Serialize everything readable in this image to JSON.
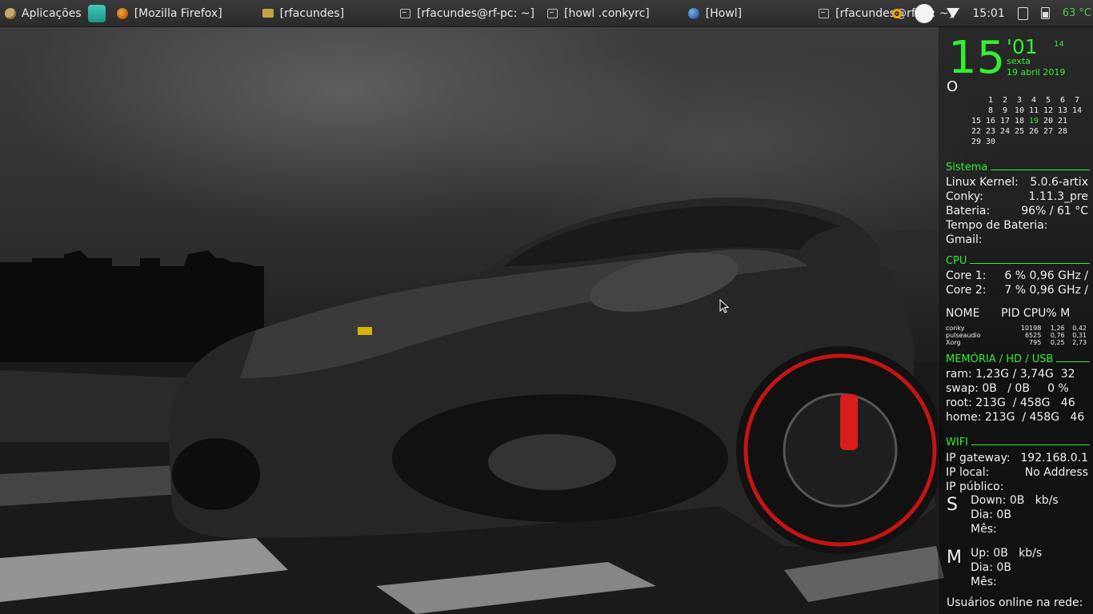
{
  "panel": {
    "apps_menu": "Aplicações",
    "tasks": [
      {
        "icon": "firefox-icon",
        "label": "[Mozilla Firefox]"
      },
      {
        "icon": "folder-icon",
        "label": "[rfacundes]"
      },
      {
        "icon": "terminal-icon",
        "label": "[rfacundes@rf-pc: ~]"
      },
      {
        "icon": "terminal-icon",
        "label": "[howl .conkyrc]"
      },
      {
        "icon": "globe-icon",
        "label": "[Howl]"
      },
      {
        "icon": "terminal-icon",
        "label": "[rfacundes@rf-pc: ~]"
      }
    ],
    "clock": "15:01",
    "temperature": "63 °C"
  },
  "conky": {
    "clock": {
      "hour": "15",
      "minute": "'01",
      "second": "14",
      "weekday": "sexta",
      "date": "19 abril 2019"
    },
    "glyph_o": "O",
    "calendar": [
      [
        "",
        "1",
        "2",
        "3",
        "4",
        "5",
        "6",
        "7"
      ],
      [
        "",
        "8",
        "9",
        "10",
        "11",
        "12",
        "13",
        "14"
      ],
      [
        "15",
        "16",
        "17",
        "18",
        "19",
        "20",
        "21",
        ""
      ],
      [
        "22",
        "23",
        "24",
        "25",
        "26",
        "27",
        "28",
        ""
      ],
      [
        "29",
        "30",
        "",
        "",
        "",
        "",
        "",
        ""
      ]
    ],
    "calendar_today": "19",
    "sistema": {
      "title": "Sistema",
      "kernel_label": "Linux Kernel:",
      "kernel": "5.0.6-artix",
      "conky_label": "Conky:",
      "conky": "1.11.3_pre",
      "battery_label": "Bateria:",
      "battery": "96% / 61 °C",
      "battery_time_label": "Tempo de Bateria:",
      "gmail_label": "Gmail:"
    },
    "cpu": {
      "title": "CPU",
      "cores": [
        {
          "label": "Core 1:",
          "value": "6 %  0,96 GHz /"
        },
        {
          "label": "Core 2:",
          "value": "7 %  0,96 GHz /"
        }
      ],
      "proc_header": "NOME      PID CPU% M",
      "processes": [
        {
          "name": "conky",
          "pid": "10198",
          "cpu": "1,26",
          "mem": "0,42"
        },
        {
          "name": "pulseaudio",
          "pid": "6525",
          "cpu": "0,76",
          "mem": "0,31"
        },
        {
          "name": "Xorg",
          "pid": "795",
          "cpu": "0,25",
          "mem": "2,73"
        }
      ]
    },
    "memory": {
      "title": "MEMÓRIA / HD / USB",
      "ram": "ram: 1,23G / 3,74G  32",
      "swap": "swap: 0B   / 0B     0 %",
      "root": "root: 213G  / 458G   46",
      "home": "home: 213G  / 458G   46"
    },
    "wifi": {
      "title": "WIFI",
      "gateway_label": "IP gateway:",
      "gateway": "192.168.0.1",
      "local_label": "IP local:",
      "local": "No Address",
      "public_label": "IP público:",
      "down_letter": "S",
      "down": "Down: 0B   kb/s",
      "down_day": "Dia: 0B",
      "down_month": "Mês:",
      "up_letter": "M",
      "up": "Up: 0B   kb/s",
      "up_day": "Dia: 0B",
      "up_month": "Mês:",
      "users_online": "Usuários online na rede:"
    }
  }
}
